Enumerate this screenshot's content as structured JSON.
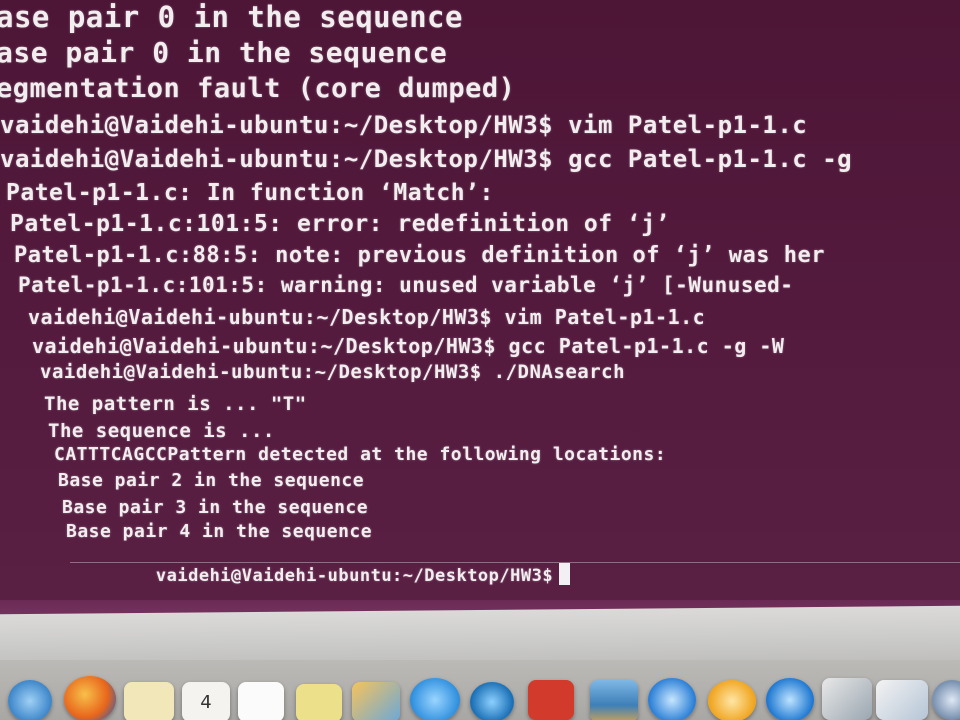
{
  "terminal": {
    "lines": [
      "ase pair 0 in the sequence",
      "ase pair 0 in the sequence",
      "egmentation fault (core dumped)",
      "vaidehi@Vaidehi-ubuntu:~/Desktop/HW3$ vim Patel-p1-1.c",
      "vaidehi@Vaidehi-ubuntu:~/Desktop/HW3$ gcc Patel-p1-1.c -g",
      "Patel-p1-1.c: In function ‘Match’:",
      "Patel-p1-1.c:101:5: error: redefinition of ‘j’",
      "Patel-p1-1.c:88:5: note: previous definition of ‘j’ was her",
      "Patel-p1-1.c:101:5: warning: unused variable ‘j’ [-Wunused-",
      "vaidehi@Vaidehi-ubuntu:~/Desktop/HW3$ vim Patel-p1-1.c",
      "vaidehi@Vaidehi-ubuntu:~/Desktop/HW3$ gcc Patel-p1-1.c -g -W",
      "vaidehi@Vaidehi-ubuntu:~/Desktop/HW3$ ./DNAsearch",
      "The pattern is ... \"T\"",
      "The sequence is ...",
      "CATTTCAGCCPattern detected at the following locations:",
      "Base pair 2 in the sequence",
      "Base pair 3 in the sequence",
      "Base pair 4 in the sequence"
    ],
    "prompt": "vaidehi@Vaidehi-ubuntu:~/Desktop/HW3$"
  },
  "dock": {
    "calendar_day": "4"
  },
  "colors": {
    "terminal_bg": "#521a3c",
    "terminal_text": "#f2eef0",
    "bezel": "#d6d4d2"
  }
}
